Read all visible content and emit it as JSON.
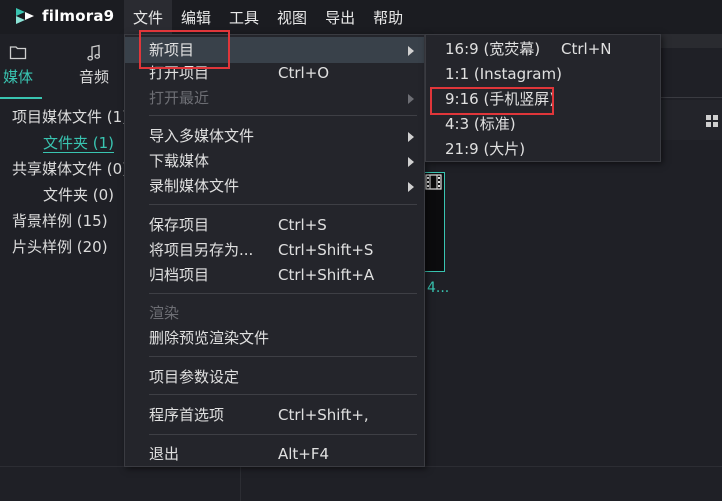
{
  "app": {
    "name": "filmora9",
    "accent": "#39c4b1",
    "highlight_box_color": "#e0363a"
  },
  "menubar": {
    "items": [
      "文件",
      "编辑",
      "工具",
      "视图",
      "导出",
      "帮助"
    ]
  },
  "left_panel": {
    "tabs": [
      {
        "label": "媒体",
        "icon": "folder-icon"
      },
      {
        "label": "音频",
        "icon": "music-note-icon"
      }
    ],
    "tree": [
      {
        "label": "项目媒体文件 (1)"
      },
      {
        "label": "文件夹 (1)"
      },
      {
        "label": "共享媒体文件 (0)"
      },
      {
        "label": "文件夹 (0)"
      },
      {
        "label": "背景样例 (15)"
      },
      {
        "label": "片头样例 (20)"
      }
    ]
  },
  "media_thumb": {
    "label": "4..."
  },
  "file_menu": {
    "items": [
      {
        "label": "新项目",
        "shortcut": "",
        "submenu": true,
        "disabled": false
      },
      {
        "label": "打开项目",
        "shortcut": "Ctrl+O",
        "submenu": false,
        "disabled": false
      },
      {
        "label": "打开最近",
        "shortcut": "",
        "submenu": true,
        "disabled": true
      },
      {
        "label": "导入多媒体文件",
        "shortcut": "",
        "submenu": true,
        "disabled": false
      },
      {
        "label": "下载媒体",
        "shortcut": "",
        "submenu": true,
        "disabled": false
      },
      {
        "label": "录制媒体文件",
        "shortcut": "",
        "submenu": true,
        "disabled": false
      },
      {
        "label": "保存项目",
        "shortcut": "Ctrl+S",
        "submenu": false,
        "disabled": false
      },
      {
        "label": "将项目另存为...",
        "shortcut": "Ctrl+Shift+S",
        "submenu": false,
        "disabled": false
      },
      {
        "label": "归档项目",
        "shortcut": "Ctrl+Shift+A",
        "submenu": false,
        "disabled": false
      },
      {
        "label": "渲染",
        "shortcut": "",
        "submenu": false,
        "disabled": true
      },
      {
        "label": "删除预览渲染文件",
        "shortcut": "",
        "submenu": false,
        "disabled": false
      },
      {
        "label": "项目参数设定",
        "shortcut": "",
        "submenu": false,
        "disabled": false
      },
      {
        "label": "程序首选项",
        "shortcut": "Ctrl+Shift+,",
        "submenu": false,
        "disabled": false
      },
      {
        "label": "退出",
        "shortcut": "Alt+F4",
        "submenu": false,
        "disabled": false
      }
    ]
  },
  "new_project_submenu": {
    "items": [
      {
        "label": "16:9 (宽荧幕)",
        "shortcut": "Ctrl+N"
      },
      {
        "label": "1:1 (Instagram)",
        "shortcut": ""
      },
      {
        "label": "9:16 (手机竖屏)",
        "shortcut": ""
      },
      {
        "label": "4:3 (标准)",
        "shortcut": ""
      },
      {
        "label": "21:9 (大片)",
        "shortcut": ""
      }
    ]
  }
}
